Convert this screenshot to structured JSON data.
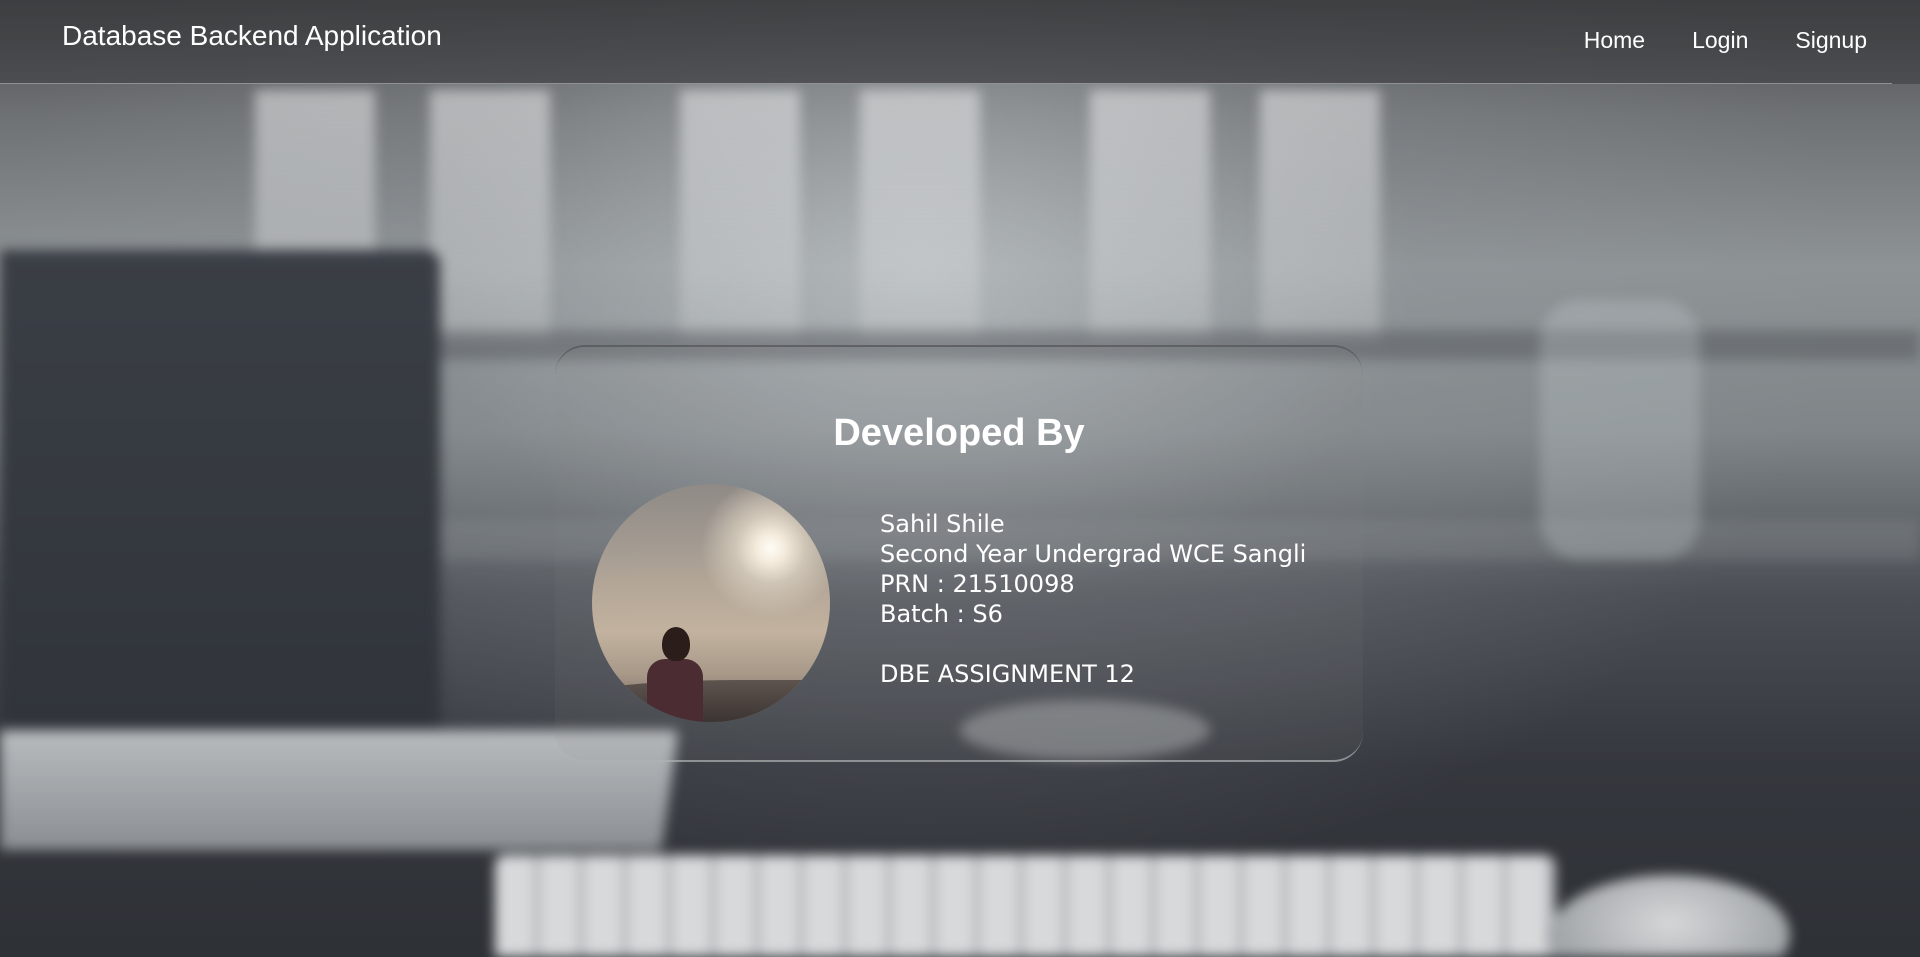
{
  "navbar": {
    "brand": "Database Backend Application",
    "links": [
      {
        "label": "Home"
      },
      {
        "label": "Login"
      },
      {
        "label": "Signup"
      }
    ]
  },
  "developer_card": {
    "title": "Developed By",
    "avatar_icon": "profile-photo",
    "name": "Sahil Shile",
    "description": "Second Year Undergrad WCE Sangli",
    "prn": "PRN : 21510098",
    "batch": "Batch : S6",
    "assignment": "DBE ASSIGNMENT 12"
  },
  "colors": {
    "text": "#ffffff",
    "navbar_bg": "#47484a",
    "background_dark": "#34373d",
    "background_light": "#8e9396"
  }
}
